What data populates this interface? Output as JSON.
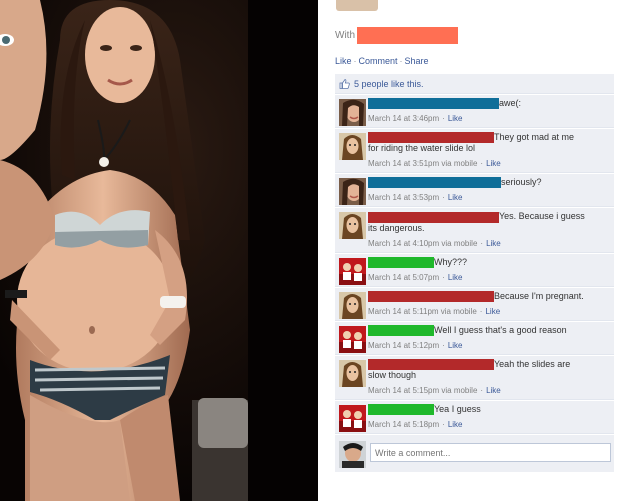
{
  "post": {
    "with_label": "With",
    "actions": {
      "like": "Like",
      "comment": "Comment",
      "share": "Share",
      "separator": "·"
    },
    "likes_text": "5 people like this."
  },
  "comments": [
    {
      "author_color": "#0f6e99",
      "author_bar_width": 131,
      "text": "awe(:",
      "wrap": "",
      "meta": "March 14 at 3:46pm",
      "action": "Like",
      "avatar": "girl-a"
    },
    {
      "author_color": "#b3292a",
      "author_bar_width": 126,
      "text": "They got mad at me",
      "wrap": "for riding the water slide lol",
      "meta": "March 14 at 3:51pm via mobile",
      "action": "Like",
      "avatar": "girl-b"
    },
    {
      "author_color": "#0f6e99",
      "author_bar_width": 133,
      "text": "seriously?",
      "wrap": "",
      "meta": "March 14 at 3:53pm",
      "action": "Like",
      "avatar": "girl-a"
    },
    {
      "author_color": "#b3292a",
      "author_bar_width": 131,
      "text": "Yes. Because i guess",
      "wrap": "its dangerous.",
      "meta": "March 14 at 4:10pm via mobile",
      "action": "Like",
      "avatar": "girl-b"
    },
    {
      "author_color": "#1fb82b",
      "author_bar_width": 66,
      "text": "Why???",
      "wrap": "",
      "meta": "March 14 at 5:07pm",
      "action": "Like",
      "avatar": "red-team"
    },
    {
      "author_color": "#b3292a",
      "author_bar_width": 126,
      "text": "Because I'm pregnant.",
      "wrap": "",
      "meta": "March 14 at 5:11pm via mobile",
      "action": "Like",
      "avatar": "girl-b"
    },
    {
      "author_color": "#1fb82b",
      "author_bar_width": 66,
      "text": "Well I guess that's a good reason",
      "wrap": "",
      "meta": "March 14 at 5:12pm",
      "action": "Like",
      "avatar": "red-team"
    },
    {
      "author_color": "#b3292a",
      "author_bar_width": 126,
      "text": "Yeah the slides are",
      "wrap": "slow though",
      "meta": "March 14 at 5:15pm via mobile",
      "action": "Like",
      "avatar": "girl-b"
    },
    {
      "author_color": "#1fb82b",
      "author_bar_width": 66,
      "text": "Yea I guess",
      "wrap": "",
      "meta": "March 14 at 5:18pm",
      "action": "Like",
      "avatar": "red-team"
    }
  ],
  "composer": {
    "placeholder": "Write a comment..."
  },
  "colors": {
    "link": "#3b5998",
    "panel_bg": "#edeff4",
    "meta": "#808080"
  }
}
